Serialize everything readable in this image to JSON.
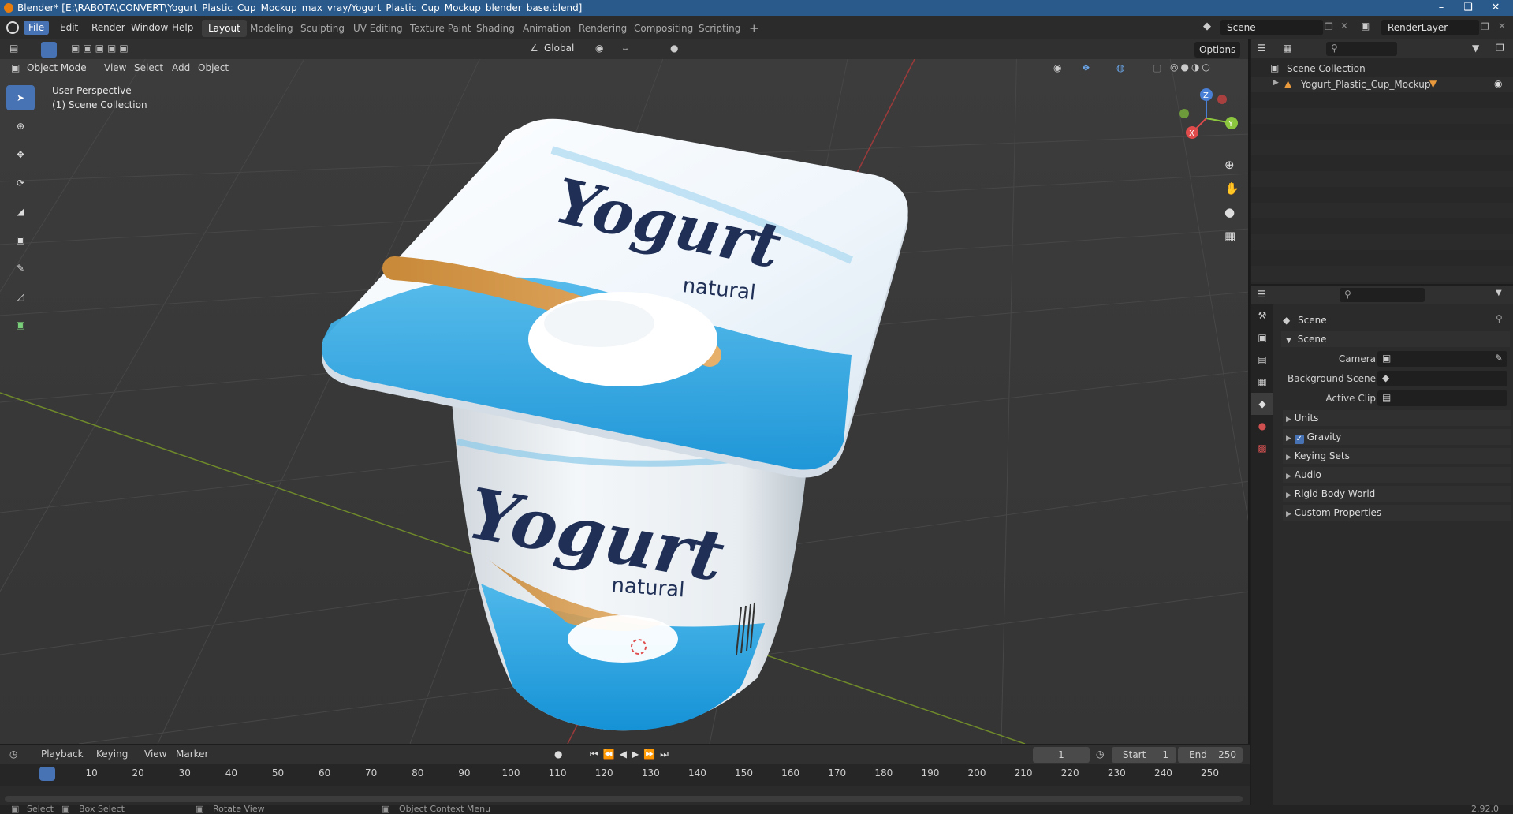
{
  "window": {
    "title": "Blender* [E:\\RABOTA\\CONVERT\\Yogurt_Plastic_Cup_Mockup_max_vray/Yogurt_Plastic_Cup_Mockup_blender_base.blend]"
  },
  "menu": [
    "File",
    "Edit",
    "Render",
    "Window",
    "Help"
  ],
  "workspaces": [
    "Layout",
    "Modeling",
    "Sculpting",
    "UV Editing",
    "Texture Paint",
    "Shading",
    "Animation",
    "Rendering",
    "Compositing",
    "Scripting"
  ],
  "scene_field": "Scene",
  "renderlayer_field": "RenderLayer",
  "viewport": {
    "mode": "Object Mode",
    "menus": [
      "View",
      "Select",
      "Add",
      "Object"
    ],
    "transform_orientation": "Global",
    "options_label": "Options",
    "overlay_text_1": "User Perspective",
    "overlay_text_2": "(1) Scene Collection",
    "product": {
      "lid_brand": "Yogurt",
      "lid_sub": "natural",
      "cup_brand": "Yogurt",
      "cup_sub": "natural"
    },
    "gizmo": {
      "x": "X",
      "y": "Y",
      "z": "Z"
    }
  },
  "outliner": {
    "root": "Scene Collection",
    "items": [
      {
        "label": "Yogurt_Plastic_Cup_Mockup"
      }
    ]
  },
  "properties": {
    "header": "Scene",
    "section": "Scene",
    "fields": [
      {
        "label": "Camera"
      },
      {
        "label": "Background Scene"
      },
      {
        "label": "Active Clip"
      }
    ],
    "panels": [
      "Units",
      "Gravity",
      "Keying Sets",
      "Audio",
      "Rigid Body World",
      "Custom Properties"
    ],
    "gravity_checked": true
  },
  "timeline": {
    "menus": [
      "Playback",
      "Keying",
      "View",
      "Marker"
    ],
    "current_frame": "1",
    "start_label": "Start",
    "start_value": "1",
    "end_label": "End",
    "end_value": "250",
    "ticks": [
      "1",
      "10",
      "20",
      "30",
      "40",
      "50",
      "60",
      "70",
      "80",
      "90",
      "100",
      "110",
      "120",
      "130",
      "140",
      "150",
      "160",
      "170",
      "180",
      "190",
      "200",
      "210",
      "220",
      "230",
      "240",
      "250"
    ]
  },
  "status": {
    "select": "Select",
    "box_select": "Box Select",
    "rotate": "Rotate View",
    "context": "Object Context Menu",
    "version": "2.92.0"
  },
  "colors": {
    "accent": "#4772b3",
    "header": "#2a5a8c",
    "lid_blue": "#2aa6e0",
    "orange": "#e87d0d"
  }
}
